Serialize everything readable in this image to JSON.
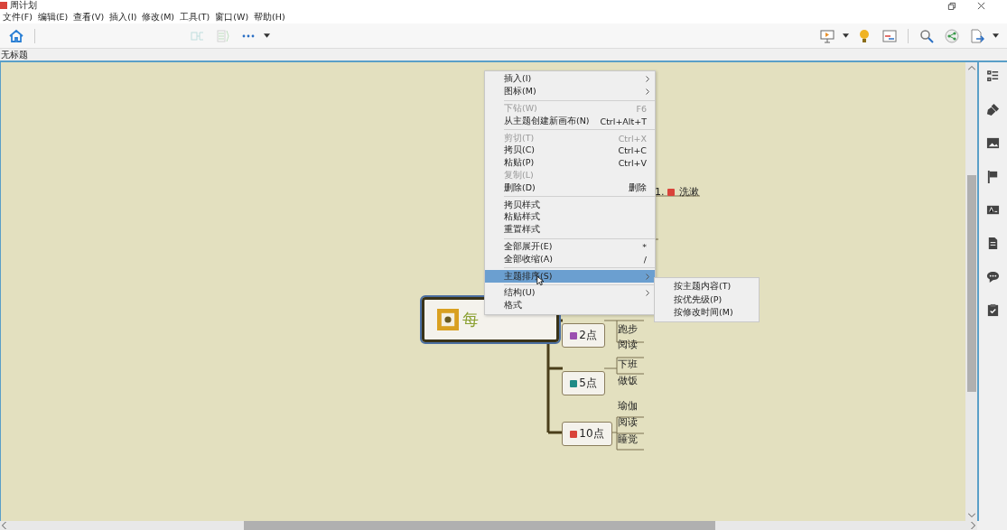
{
  "window": {
    "title": "周计划"
  },
  "menubar": [
    "文件(F)",
    "编辑(E)",
    "查看(V)",
    "插入(I)",
    "修改(M)",
    "工具(T)",
    "窗口(W)",
    "帮助(H)"
  ],
  "tab": {
    "label": "无标题"
  },
  "mindmap": {
    "central": "每",
    "floating": {
      "number": "1.",
      "text": "洗漱",
      "color": "#d9433a"
    },
    "topics": [
      {
        "label": "2点",
        "color": "#9b4fb0",
        "children": [
          "跑步",
          "阅读"
        ]
      },
      {
        "label": "5点",
        "color": "#1f8a86",
        "children": [
          "下班",
          "做饭"
        ]
      },
      {
        "label": "10点",
        "color": "#d9433a",
        "children": [
          "瑜伽",
          "阅读",
          "睡觉"
        ]
      }
    ]
  },
  "context_menu": {
    "groups": [
      [
        {
          "label": "插入(I)",
          "disabled": false,
          "submenu": true,
          "selected": false
        },
        {
          "label": "图标(M)",
          "disabled": false,
          "submenu": true,
          "selected": false
        }
      ],
      [
        {
          "label": "下钻(W)",
          "shortcut": "F6",
          "disabled": true,
          "submenu": false,
          "selected": false
        },
        {
          "label": "从主题创建新画布(N)",
          "shortcut": "Ctrl+Alt+T",
          "disabled": false,
          "submenu": false,
          "selected": false
        }
      ],
      [
        {
          "label": "剪切(T)",
          "shortcut": "Ctrl+X",
          "disabled": true,
          "submenu": false,
          "selected": false
        },
        {
          "label": "拷贝(C)",
          "shortcut": "Ctrl+C",
          "disabled": false,
          "submenu": false,
          "selected": false
        },
        {
          "label": "粘贴(P)",
          "shortcut": "Ctrl+V",
          "disabled": false,
          "submenu": false,
          "selected": false
        },
        {
          "label": "复制(L)",
          "disabled": true,
          "submenu": false,
          "selected": false
        },
        {
          "label": "删除(D)",
          "shortcut": "删除",
          "disabled": false,
          "submenu": false,
          "selected": false
        }
      ],
      [
        {
          "label": "拷贝样式",
          "disabled": false,
          "submenu": false,
          "selected": false
        },
        {
          "label": "粘贴样式",
          "disabled": false,
          "submenu": false,
          "selected": false
        },
        {
          "label": "重置样式",
          "disabled": false,
          "submenu": false,
          "selected": false
        }
      ],
      [
        {
          "label": "全部展开(E)",
          "shortcut": "*",
          "disabled": false,
          "submenu": false,
          "selected": false
        },
        {
          "label": "全部收缩(A)",
          "shortcut": "/",
          "disabled": false,
          "submenu": false,
          "selected": false
        }
      ],
      [
        {
          "label": "主题排序(S)",
          "disabled": false,
          "submenu": true,
          "selected": true
        }
      ],
      [
        {
          "label": "结构(U)",
          "disabled": false,
          "submenu": true,
          "selected": false
        },
        {
          "label": "格式",
          "disabled": false,
          "submenu": false,
          "selected": false
        }
      ]
    ],
    "submenu": [
      "按主题内容(T)",
      "按优先级(P)",
      "按修改时间(M)"
    ]
  }
}
